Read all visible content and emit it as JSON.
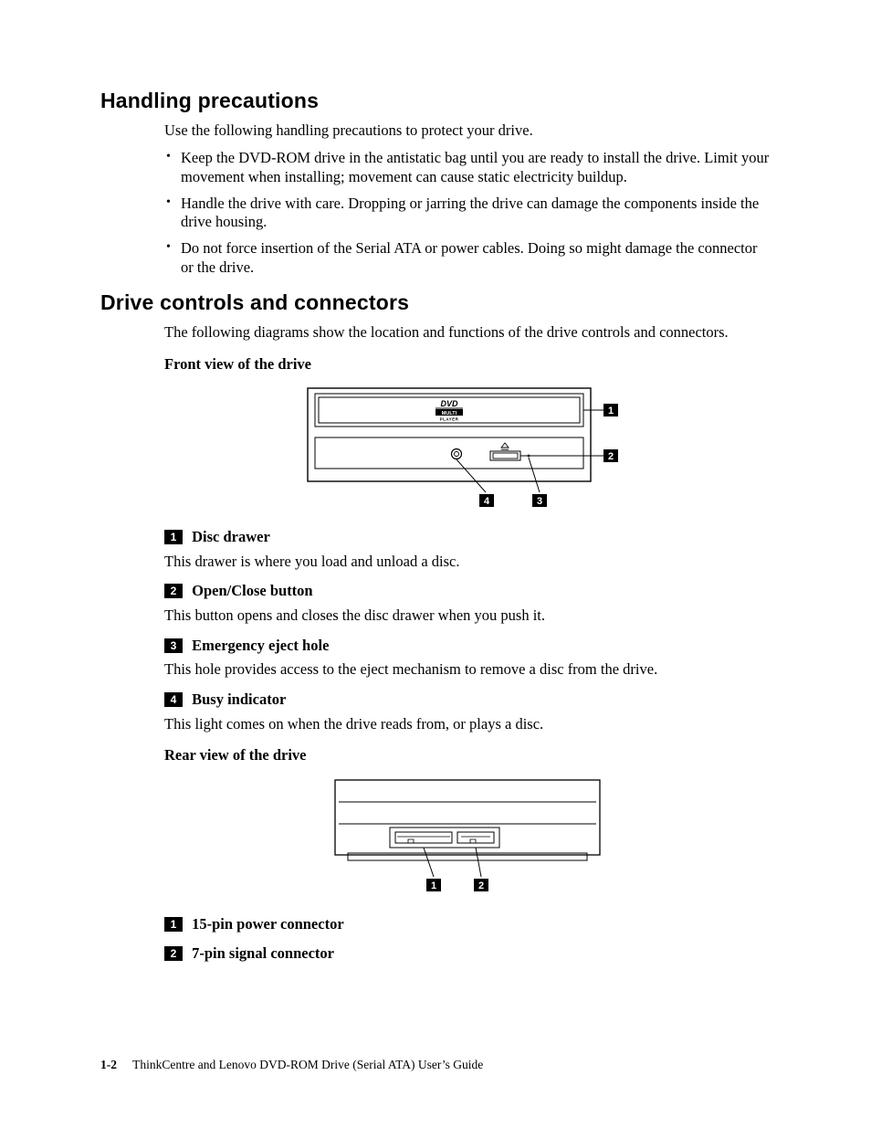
{
  "headings": {
    "precautions": "Handling precautions",
    "connectors": "Drive controls and connectors"
  },
  "precautions": {
    "intro": "Use the following handling precautions to protect your drive.",
    "items": [
      "Keep the DVD-ROM drive in the antistatic bag until you are ready to install the drive. Limit your movement when installing; movement can cause static electricity buildup.",
      "Handle the drive with care. Dropping or jarring the drive can damage the components inside the drive housing.",
      "Do not force insertion of the Serial ATA or power cables. Doing so might damage the connector or the drive."
    ]
  },
  "connectors": {
    "intro": "The following diagrams show the location and functions of the drive controls and connectors."
  },
  "front": {
    "title": "Front view of the drive",
    "logo_top": "DVD",
    "logo_mid": "MULTI",
    "logo_bot": "PLAYER",
    "callouts": {
      "1": {
        "num": "1",
        "label": "Disc drawer",
        "desc": "This drawer is where you load and unload a disc."
      },
      "2": {
        "num": "2",
        "label": "Open/Close button",
        "desc": "This button opens and closes the disc drawer when you push it."
      },
      "3": {
        "num": "3",
        "label": "Emergency eject hole",
        "desc": "This hole provides access to the eject mechanism to remove a disc from the drive."
      },
      "4": {
        "num": "4",
        "label": "Busy indicator",
        "desc": "This light comes on when the drive reads from, or plays a disc."
      }
    }
  },
  "rear": {
    "title": "Rear view of the drive",
    "callouts": {
      "1": {
        "num": "1",
        "label": "15-pin power connector"
      },
      "2": {
        "num": "2",
        "label": "7-pin signal connector"
      }
    }
  },
  "footer": {
    "pagenum": "1-2",
    "title": "ThinkCentre and Lenovo DVD-ROM Drive (Serial ATA) User’s Guide"
  }
}
